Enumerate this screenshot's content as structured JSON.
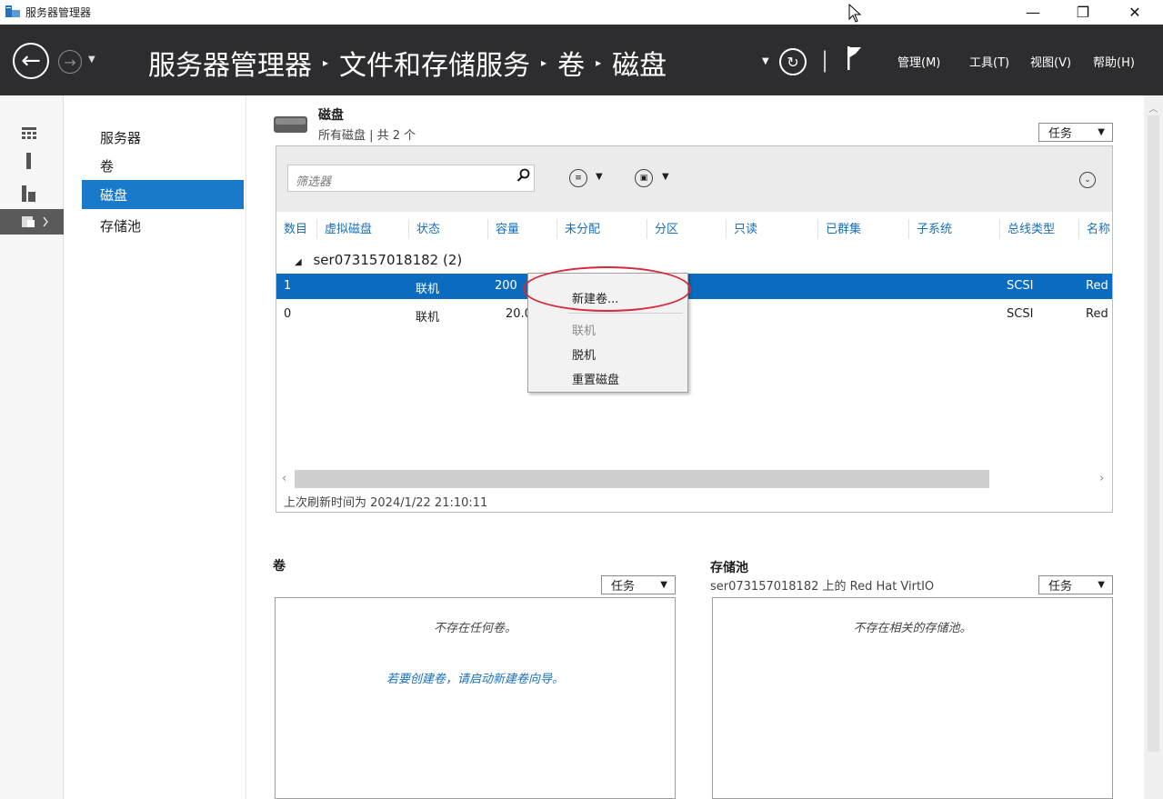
{
  "window": {
    "title": "服务器管理器",
    "minimize_glyph": "—",
    "restore_glyph": "❐",
    "close_glyph": "✕"
  },
  "header": {
    "back_glyph": "←",
    "forward_glyph": "→",
    "breadcrumb": [
      "服务器管理器",
      "文件和存储服务",
      "卷",
      "磁盘"
    ],
    "breadcrumb_sep": "▸",
    "refresh_glyph": "↻",
    "menu": [
      "管理(M)",
      "工具(T)",
      "视图(V)",
      "帮助(H)"
    ]
  },
  "nav": {
    "items": [
      "服务器",
      "卷",
      "磁盘",
      "存储池"
    ],
    "active_index": 2
  },
  "disks": {
    "title": "磁盘",
    "subtitle": "所有磁盘 | 共 2 个",
    "tasks_label": "任务",
    "filter_placeholder": "筛选器",
    "columns": [
      "数目",
      "虚拟磁盘",
      "状态",
      "容量",
      "未分配",
      "分区",
      "只读",
      "已群集",
      "子系统",
      "总线类型",
      "名称"
    ],
    "group_label": "ser073157018182 (2)",
    "rows": [
      {
        "number": "1",
        "status": "联机",
        "capacity": "200",
        "bus": "SCSI",
        "name": "Red",
        "selected": true
      },
      {
        "number": "0",
        "status": "联机",
        "capacity": "20.0",
        "bus": "SCSI",
        "name": "Red",
        "selected": false
      }
    ],
    "last_refresh": "上次刷新时间为 2024/1/22 21:10:11"
  },
  "context_menu": {
    "items": [
      {
        "label": "新建卷...",
        "disabled": false
      },
      {
        "label": "联机",
        "disabled": true
      },
      {
        "label": "脱机",
        "disabled": false
      },
      {
        "label": "重置磁盘",
        "disabled": false
      }
    ]
  },
  "volumes": {
    "title": "卷",
    "tasks_label": "任务",
    "empty_message": "不存在任何卷。",
    "create_hint": "若要创建卷，请启动新建卷向导。"
  },
  "storage_pool": {
    "title": "存储池",
    "subtitle": "ser073157018182 上的 Red Hat VirtIO",
    "tasks_label": "任务",
    "empty_message": "不存在相关的存储池。"
  },
  "colors": {
    "header_bg": "#2d2d30",
    "accent": "#1979ca",
    "selection": "#0b6cbf",
    "highlight_ring": "#d7293a"
  }
}
